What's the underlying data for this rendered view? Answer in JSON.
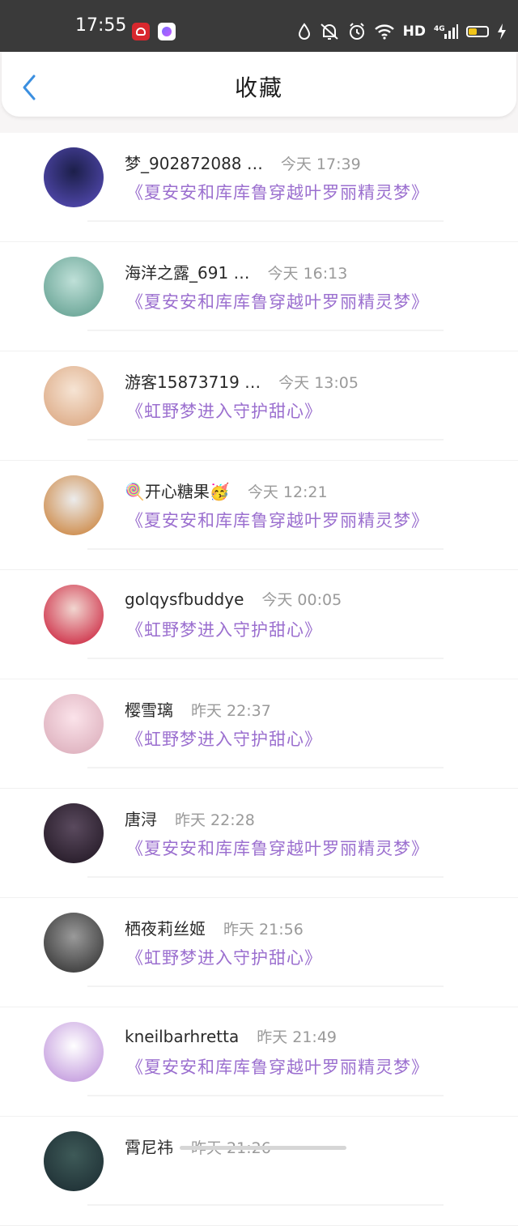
{
  "status_bar": {
    "time": "17:55",
    "hd": "HD",
    "network": "4G",
    "icons": [
      "app-notification-red",
      "app-notification-purple",
      "water-drop-icon",
      "mute-icon",
      "alarm-icon",
      "wifi-icon",
      "signal-icon",
      "battery-icon",
      "charging-icon"
    ]
  },
  "header": {
    "title": "收藏",
    "back_icon": "chevron-left-icon"
  },
  "items": [
    {
      "name": "梦_902872088 …",
      "time": "今天 17:39",
      "book": "《夏安安和库库鲁穿越叶罗丽精灵梦》",
      "avatar_colors": [
        "#1c1f4a",
        "#5a4fbf"
      ]
    },
    {
      "name": "海洋之露_691 …",
      "time": "今天 16:13",
      "book": "《夏安安和库库鲁穿越叶罗丽精灵梦》",
      "avatar_colors": [
        "#bfe0d8",
        "#5a9a8a"
      ]
    },
    {
      "name": "游客15873719 …",
      "time": "今天 13:05",
      "book": "《虹野梦进入守护甜心》",
      "avatar_colors": [
        "#f6e4d4",
        "#d9a27a"
      ]
    },
    {
      "name": "🍭开心糖果🥳",
      "time": "今天 12:21",
      "book": "《夏安安和库库鲁穿越叶罗丽精灵梦》",
      "avatar_colors": [
        "#ececec",
        "#c8782a"
      ]
    },
    {
      "name": "golqysfbuddye",
      "time": "今天 00:05",
      "book": "《虹野梦进入守护甜心》",
      "avatar_colors": [
        "#f1d6d0",
        "#c8102e"
      ]
    },
    {
      "name": "樱雪璃",
      "time": "昨天 22:37",
      "book": "《虹野梦进入守护甜心》",
      "avatar_colors": [
        "#fbe3ea",
        "#d8a8b6"
      ]
    },
    {
      "name": "唐浔",
      "time": "昨天 22:28",
      "book": "《夏安安和库库鲁穿越叶罗丽精灵梦》",
      "avatar_colors": [
        "#5a4a5e",
        "#1e1420"
      ]
    },
    {
      "name": "栖夜莉丝姬",
      "time": "昨天 21:56",
      "book": "《虹野梦进入守护甜心》",
      "avatar_colors": [
        "#9a9a9a",
        "#2a2a2a"
      ]
    },
    {
      "name": "kneilbarhretta",
      "time": "昨天 21:49",
      "book": "《夏安安和库库鲁穿越叶罗丽精灵梦》",
      "avatar_colors": [
        "#ffffff",
        "#b98ad8"
      ]
    },
    {
      "name": "霄尼祎",
      "time": "昨天 21:26",
      "book": "",
      "avatar_colors": [
        "#3e5a58",
        "#1a2a30"
      ]
    }
  ]
}
